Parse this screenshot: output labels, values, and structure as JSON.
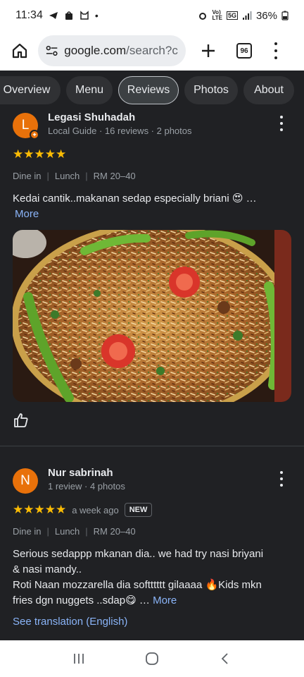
{
  "status": {
    "time": "11:34",
    "battery": "36%"
  },
  "browser": {
    "url_domain": "google.com",
    "url_path": "/search?cli",
    "tab_count": "96"
  },
  "chips": [
    {
      "label": "Overview"
    },
    {
      "label": "Menu"
    },
    {
      "label": "Reviews"
    },
    {
      "label": "Photos"
    },
    {
      "label": "About"
    }
  ],
  "reviews": [
    {
      "avatar_letter": "L",
      "name": "Legasi Shuhadah",
      "meta": "Local Guide · 16 reviews · 2 photos",
      "stars": "★★★★★",
      "tags": [
        "Dine in",
        "Lunch",
        "RM 20–40"
      ],
      "text": "Kedai cantik..makanan sedap especially briani 😍 …",
      "more_label": "More"
    },
    {
      "avatar_letter": "N",
      "name": "Nur sabrinah",
      "meta": "1 review · 4 photos",
      "stars": "★★★★★",
      "time": "a week ago",
      "badge": "NEW",
      "tags": [
        "Dine in",
        "Lunch",
        "RM 20–40"
      ],
      "text_line1": "Serious sedappp mkanan dia.. we had try nasi briyani & nasi mandy..",
      "text_line2": "Roti Naan mozzarella dia softttttt gilaaaa 🔥Kids mkn fries dgn nuggets ..sdap😋 …",
      "more_label": "More",
      "translation_label": "See translation (English)"
    }
  ],
  "colors": {
    "background": "#202124",
    "star": "#fbbc04",
    "link": "#8ab4f8",
    "avatar": "#e8710a"
  },
  "icons": {
    "home": "home-icon",
    "plus": "plus-icon",
    "like": "thumb-up-icon",
    "nav_recent": "recent-apps-icon",
    "nav_home": "nav-home-icon",
    "nav_back": "back-icon"
  }
}
